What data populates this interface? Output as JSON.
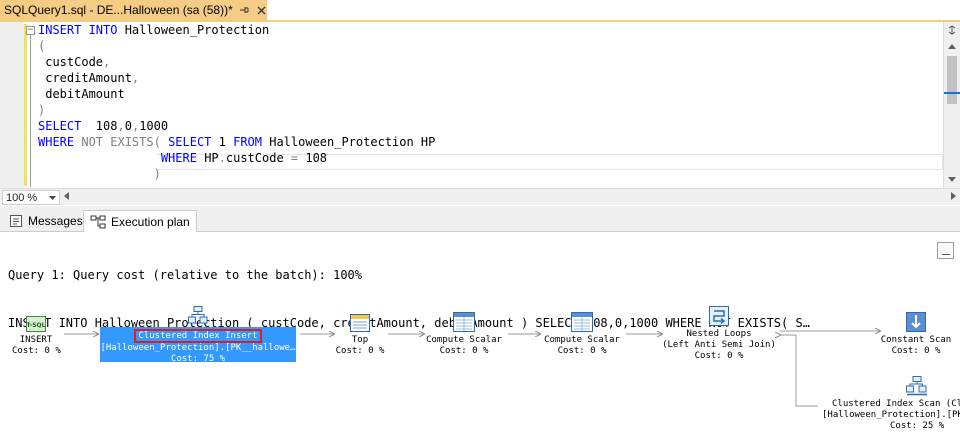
{
  "document_tab": {
    "title": "SQLQuery1.sql - DE...Halloween (sa (58))*"
  },
  "editor": {
    "lines": [
      {
        "parts": [
          {
            "cls": "kw",
            "text": "INSERT INTO "
          },
          {
            "cls": "txt",
            "text": "Halloween_Protection"
          }
        ]
      },
      {
        "parts": [
          {
            "cls": "gray",
            "text": "("
          }
        ]
      },
      {
        "parts": [
          {
            "cls": "txt",
            "text": " custCode"
          },
          {
            "cls": "gray",
            "text": ","
          }
        ]
      },
      {
        "parts": [
          {
            "cls": "txt",
            "text": " creditAmount"
          },
          {
            "cls": "gray",
            "text": ","
          }
        ]
      },
      {
        "parts": [
          {
            "cls": "txt",
            "text": " debitAmount"
          }
        ]
      },
      {
        "parts": [
          {
            "cls": "gray",
            "text": ")"
          }
        ]
      },
      {
        "parts": [
          {
            "cls": "kw",
            "text": "SELECT  "
          },
          {
            "cls": "txt",
            "text": "108"
          },
          {
            "cls": "gray",
            "text": ","
          },
          {
            "cls": "txt",
            "text": "0"
          },
          {
            "cls": "gray",
            "text": ","
          },
          {
            "cls": "txt",
            "text": "1000"
          }
        ]
      },
      {
        "parts": [
          {
            "cls": "kw",
            "text": "WHERE "
          },
          {
            "cls": "gray",
            "text": "NOT EXISTS( "
          },
          {
            "cls": "kw",
            "text": "SELECT "
          },
          {
            "cls": "txt",
            "text": "1 "
          },
          {
            "cls": "kw",
            "text": "FROM "
          },
          {
            "cls": "txt",
            "text": "Halloween_Protection HP"
          }
        ]
      },
      {
        "parts": [
          {
            "cls": "txt",
            "text": "                 "
          },
          {
            "cls": "kw",
            "text": "WHERE "
          },
          {
            "cls": "txt",
            "text": "HP"
          },
          {
            "cls": "gray",
            "text": "."
          },
          {
            "cls": "txt",
            "text": "custCode "
          },
          {
            "cls": "gray",
            "text": "= "
          },
          {
            "cls": "txt",
            "text": "108"
          }
        ]
      },
      {
        "parts": [
          {
            "cls": "gray",
            "text": "                )"
          }
        ]
      }
    ]
  },
  "zoom": {
    "value": "100 %"
  },
  "results_tabs": {
    "messages": "Messages",
    "execution_plan": "Execution plan"
  },
  "plan": {
    "header_line1": "Query 1: Query cost (relative to the batch): 100%",
    "header_line2": "INSERT INTO Halloween_Protection ( custCode, creditAmount, debitAmount ) SELECT 108,0,1000 WHERE NOT EXISTS( S…",
    "nodes": {
      "insert": {
        "icon": "tsql-icon",
        "name": "INSERT",
        "cost": "Cost: 0 %"
      },
      "clustered_insert": {
        "icon": "clustered-index-insert-icon",
        "name": "Clustered Index Insert",
        "object": "[Halloween_Protection].[PK__hallowe…",
        "cost": "Cost: 75 %"
      },
      "top": {
        "icon": "top-icon",
        "name": "Top",
        "cost": "Cost: 0 %"
      },
      "compute_scalar_1": {
        "icon": "compute-scalar-icon",
        "name": "Compute Scalar",
        "cost": "Cost: 0 %"
      },
      "compute_scalar_2": {
        "icon": "compute-scalar-icon",
        "name": "Compute Scalar",
        "cost": "Cost: 0 %"
      },
      "nested_loops": {
        "icon": "nested-loops-icon",
        "name": "Nested Loops",
        "detail": "(Left Anti Semi Join)",
        "cost": "Cost: 0 %"
      },
      "constant_scan": {
        "icon": "constant-scan-icon",
        "name": "Constant Scan",
        "cost": "Cost: 0 %"
      },
      "clustered_scan": {
        "icon": "clustered-index-scan-icon",
        "name": "Clustered Index Scan (Cl",
        "object": "[Halloween_Protection].[PK",
        "cost": "Cost: 25 %"
      }
    }
  }
}
